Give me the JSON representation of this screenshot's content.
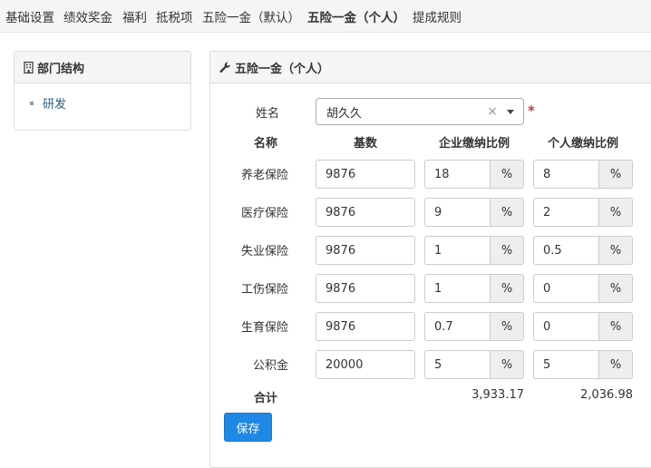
{
  "nav": {
    "tabs": [
      "基础设置",
      "绩效奖金",
      "福利",
      "抵税项",
      "五险一金（默认）",
      "五险一金（个人）",
      "提成规则"
    ]
  },
  "dept_panel": {
    "title": "部门结构",
    "items": [
      "研发"
    ]
  },
  "form_panel": {
    "title": "五险一金（个人）",
    "name_label": "姓名",
    "name_value": "胡久久",
    "clear_glyph": "×",
    "required_mark": "*",
    "headers": {
      "name": "名称",
      "base": "基数",
      "company": "企业缴纳比例",
      "personal": "个人缴纳比例"
    },
    "percent": "%",
    "rows": [
      {
        "name": "养老保险",
        "base": "9876",
        "company": "18",
        "personal": "8"
      },
      {
        "name": "医疗保险",
        "base": "9876",
        "company": "9",
        "personal": "2"
      },
      {
        "name": "失业保险",
        "base": "9876",
        "company": "1",
        "personal": "0.5"
      },
      {
        "name": "工伤保险",
        "base": "9876",
        "company": "1",
        "personal": "0"
      },
      {
        "name": "生育保险",
        "base": "9876",
        "company": "0.7",
        "personal": "0"
      },
      {
        "name": "公积金",
        "base": "20000",
        "company": "5",
        "personal": "5"
      }
    ],
    "total_label": "合计",
    "total_company": "3,933.17",
    "total_personal": "2,036.98",
    "save_label": "保存"
  }
}
